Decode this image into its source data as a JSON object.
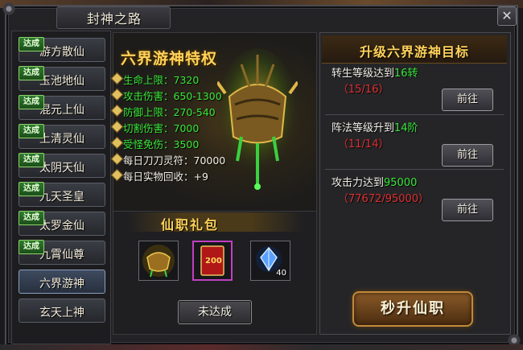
{
  "window": {
    "title": "封神之路",
    "close_glyph": "✕"
  },
  "sidebar": {
    "badge_text": "达成",
    "items": [
      {
        "label": "游方散仙",
        "completed": true
      },
      {
        "label": "玉池地仙",
        "completed": true
      },
      {
        "label": "混元上仙",
        "completed": true
      },
      {
        "label": "上清灵仙",
        "completed": true
      },
      {
        "label": "太阴天仙",
        "completed": true
      },
      {
        "label": "九天圣皇",
        "completed": true
      },
      {
        "label": "太罗金仙",
        "completed": true
      },
      {
        "label": "九霄仙尊",
        "completed": true
      },
      {
        "label": "六界游神",
        "completed": false,
        "selected": true
      },
      {
        "label": "玄天上神",
        "completed": false
      }
    ]
  },
  "privilege": {
    "title": "六界游神特权",
    "stats": [
      {
        "label": "生命上限：7320",
        "color": "green"
      },
      {
        "label": "攻击伤害：650-1300",
        "color": "green"
      },
      {
        "label": "防御上限：270-540",
        "color": "green"
      },
      {
        "label": "切割伤害：7000",
        "color": "green"
      },
      {
        "label": "受怪免伤：3500",
        "color": "green"
      },
      {
        "label": "每日刀刀灵符：70000",
        "color": "white"
      },
      {
        "label": "每日实物回收：+9",
        "color": "white"
      }
    ]
  },
  "gift": {
    "title": "仙职礼包",
    "items": [
      {
        "icon": "golden-cauldron-icon"
      },
      {
        "icon": "red-token-200-icon",
        "token_text": "200"
      },
      {
        "icon": "blue-crystal-icon",
        "count": "40"
      }
    ],
    "status_button": "未达成"
  },
  "goals": {
    "title": "升级六界游神目标",
    "action_label": "前往",
    "items": [
      {
        "prefix": "转生等级达到",
        "target": "16转",
        "progress": "（15/16）"
      },
      {
        "prefix": "阵法等级升到",
        "target": "14阶",
        "progress": "（11/14）"
      },
      {
        "prefix": "攻击力达到",
        "target": "95000",
        "progress": "（77672/95000）"
      }
    ]
  },
  "upgrade_button": "秒升仙职",
  "colors": {
    "highlight_green": "#38e838",
    "progress_red": "#e03030",
    "title_gold": "#ffd35a",
    "badge_green": "#2f7a2f"
  }
}
